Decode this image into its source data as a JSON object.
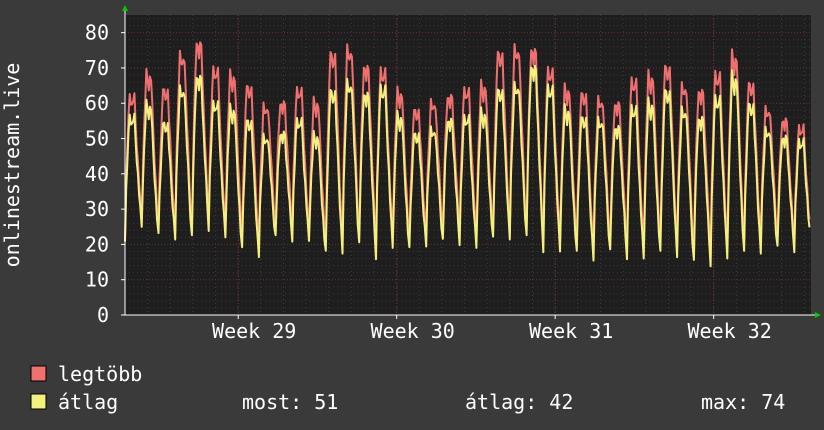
{
  "chart_data": {
    "type": "line",
    "ylabel": "onlinestream.live",
    "ylim": [
      0,
      85
    ],
    "yticks": [
      0,
      10,
      20,
      30,
      40,
      50,
      60,
      70,
      80
    ],
    "xticks": [
      {
        "label": "Week 29",
        "t": 5.0
      },
      {
        "label": "Week 30",
        "t": 12.0
      },
      {
        "label": "Week 31",
        "t": 19.0
      },
      {
        "label": "Week 32",
        "t": 26.0
      }
    ],
    "xrange": [
      0,
      30.3
    ],
    "grid": true,
    "series": [
      {
        "name": "legtöbb",
        "color": "#f07070",
        "daily_peaks": [
          64,
          70,
          66,
          76,
          80,
          72,
          70,
          67,
          61,
          62,
          66,
          62,
          77,
          78,
          73,
          72,
          65,
          60,
          62,
          64,
          66,
          67,
          77,
          78,
          78,
          72,
          66,
          65,
          63,
          62,
          69,
          70,
          73,
          67,
          66,
          71,
          76,
          68,
          60,
          57,
          55
        ],
        "daily_lows": [
          23,
          27,
          24,
          24,
          24,
          27,
          24,
          22,
          20,
          25,
          25,
          23,
          20,
          21,
          22,
          20,
          22,
          21,
          23,
          24,
          24,
          22,
          23,
          24,
          24,
          22,
          21,
          20,
          19,
          21,
          20,
          19,
          20,
          20,
          18,
          18,
          19,
          20,
          21,
          22,
          21
        ]
      },
      {
        "name": "átlag",
        "color": "#f4f080",
        "daily_peaks": [
          58,
          61,
          56,
          66,
          70,
          62,
          60,
          57,
          52,
          53,
          57,
          52,
          66,
          68,
          65,
          67,
          58,
          53,
          54,
          57,
          58,
          59,
          66,
          67,
          73,
          67,
          60,
          58,
          57,
          55,
          61,
          62,
          66,
          60,
          58,
          64,
          70,
          62,
          54,
          52,
          51
        ],
        "daily_lows": [
          22,
          25,
          22,
          22,
          22,
          25,
          22,
          18,
          17,
          22,
          22,
          21,
          17,
          18,
          20,
          17,
          19,
          18,
          20,
          21,
          21,
          19,
          21,
          22,
          22,
          19,
          18,
          17,
          16,
          18,
          17,
          16,
          17,
          17,
          15,
          15,
          16,
          17,
          18,
          19,
          19
        ]
      }
    ],
    "legend": [
      {
        "label": "legtöbb",
        "color": "#f07070"
      },
      {
        "label": "átlag",
        "color": "#f4f080"
      }
    ],
    "stats": {
      "now_label": "most: 51",
      "avg_label": "átlag: 42",
      "max_label": "max: 74"
    }
  }
}
